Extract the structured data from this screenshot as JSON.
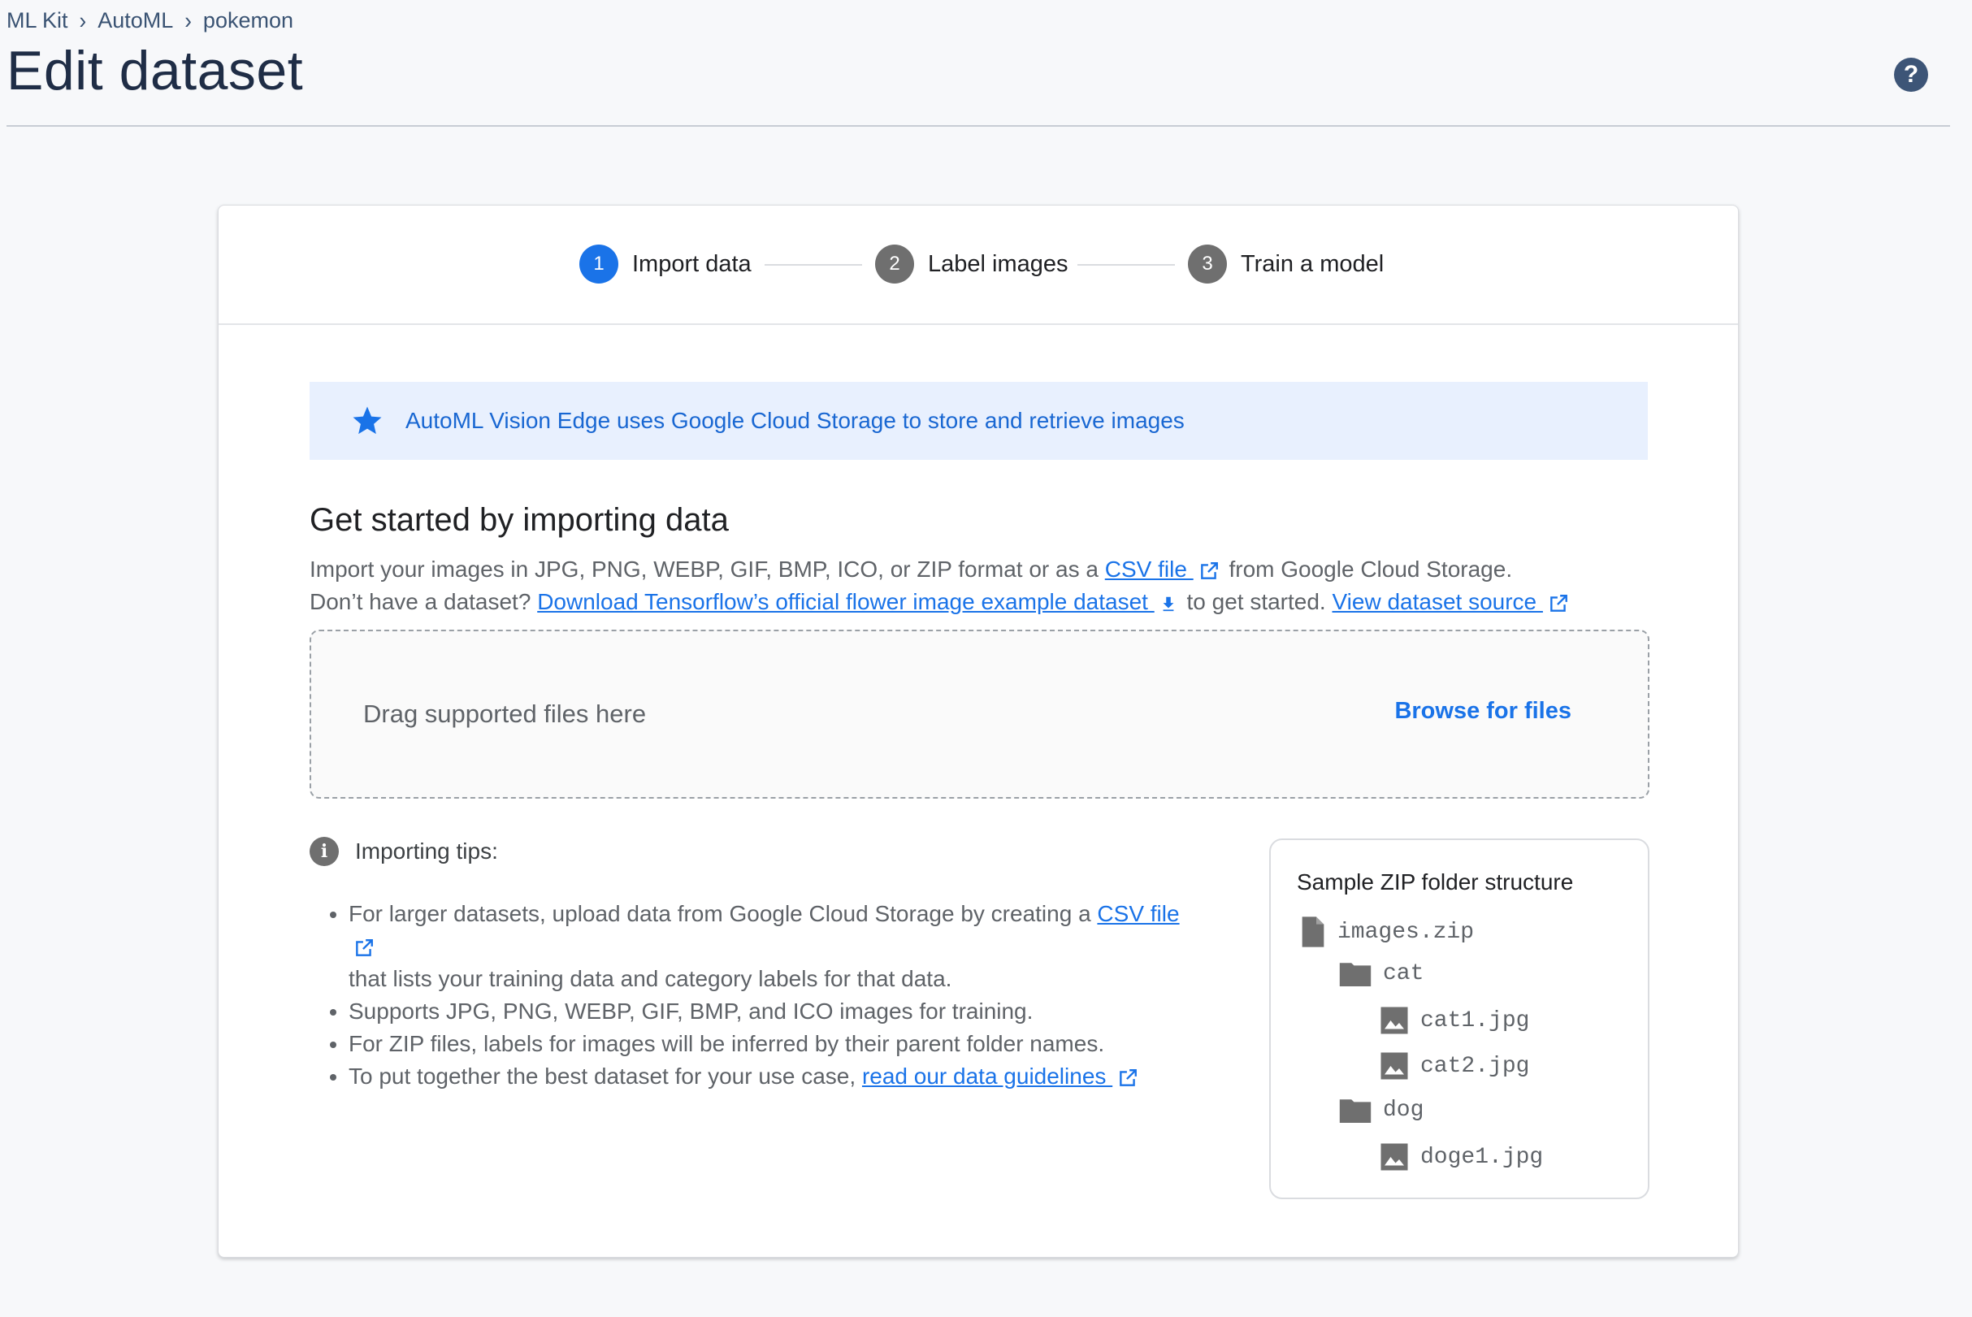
{
  "breadcrumb": [
    "ML Kit",
    "AutoML",
    "pokemon"
  ],
  "page_title": "Edit dataset",
  "help_icon": "?",
  "stepper": {
    "steps": [
      {
        "number": "1",
        "label": "Import data",
        "state": "active"
      },
      {
        "number": "2",
        "label": "Label images",
        "state": "inactive"
      },
      {
        "number": "3",
        "label": "Train a model",
        "state": "inactive"
      }
    ]
  },
  "banner": {
    "icon": "star-icon",
    "text": "AutoML Vision Edge uses Google Cloud Storage to store and retrieve images"
  },
  "section_title": "Get started by importing data",
  "intro": {
    "line1_before": "Import your images in JPG, PNG, WEBP, GIF, BMP, ICO, or ZIP format or as a ",
    "line1_link": "CSV file ",
    "line1_after": " from Google Cloud Storage.",
    "line2_before": "Don’t have a dataset? ",
    "line2_link": "Download Tensorflow’s official flower image example dataset ",
    "line2_middle": " to get started. ",
    "line2_link2": "View dataset source "
  },
  "dropzone": {
    "text": "Drag supported files here",
    "browse": "Browse for files"
  },
  "tips": {
    "title": "Importing tips:",
    "item1_before": "For larger datasets, upload data from Google Cloud Storage by creating a ",
    "item1_link": "CSV file ",
    "item1_after": "that lists your training data and category labels for that data.",
    "item2": "Supports JPG, PNG, WEBP, GIF, BMP, and ICO images for training.",
    "item3": "For ZIP files, labels for images will be inferred by their parent folder names.",
    "item4_before": "To put together the best dataset for your use case, ",
    "item4_link": "read our data guidelines "
  },
  "sample": {
    "title": "Sample ZIP folder structure",
    "items": [
      {
        "name": "images.zip",
        "icon": "file-icon"
      },
      {
        "name": "cat",
        "icon": "folder-icon"
      },
      {
        "name": "cat1.jpg",
        "icon": "image-icon"
      },
      {
        "name": "cat2.jpg",
        "icon": "image-icon"
      },
      {
        "name": "dog",
        "icon": "folder-icon"
      },
      {
        "name": "doge1.jpg",
        "icon": "image-icon"
      }
    ]
  },
  "colors": {
    "accent": "#1a73e8",
    "banner_bg": "#e8f0fe",
    "title": "#1f2d46"
  }
}
